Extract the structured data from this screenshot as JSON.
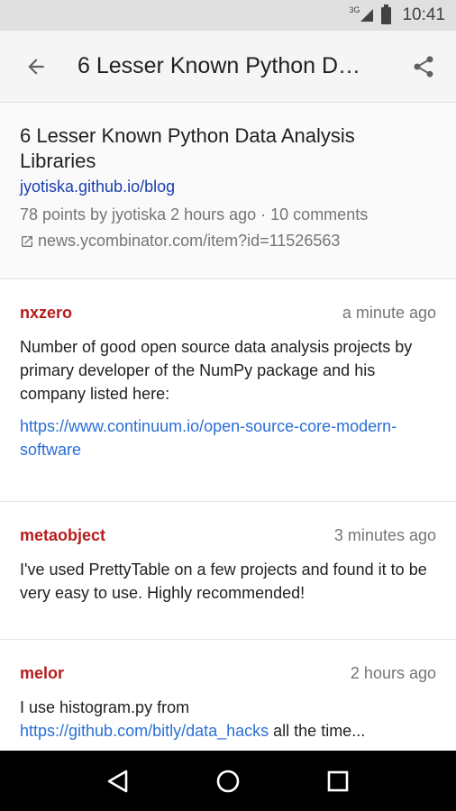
{
  "status_bar": {
    "network": "3G",
    "time": "10:41",
    "icons": [
      "signal-icon",
      "battery-icon"
    ]
  },
  "app_bar": {
    "title": "6 Lesser Known Python D…",
    "icons": [
      "back-arrow-icon",
      "share-icon"
    ]
  },
  "story": {
    "title": "6 Lesser Known Python Data Analysis Libraries",
    "domain": "jyotiska.github.io/blog",
    "meta": "78 points by jyotiska 2 hours ago · 10 comments",
    "link": "news.ycombinator.com/item?id=11526563",
    "link_icon": "external-link-icon"
  },
  "comments": [
    {
      "user": "nxzero",
      "time": "a minute ago",
      "text": "Number of good open source data analysis projects by primary developer of the NumPy package and his company listed here:",
      "link": "https://www.continuum.io/open-source-core-modern-software"
    },
    {
      "user": "metaobject",
      "time": "3 minutes ago",
      "text": "I've used PrettyTable on a few projects and found it to be very easy to use. Highly recommended!"
    },
    {
      "user": "melor",
      "time": "2 hours ago",
      "text_before": "I use histogram.py from ",
      "link": "https://github.com/bitly/data_hacks",
      "text_after": " all the time..."
    }
  ],
  "nav_bar": {
    "icons": [
      "back-triangle-icon",
      "home-circle-icon",
      "recents-square-icon"
    ]
  },
  "colors": {
    "username": "#b71c1c",
    "link": "#2a6ed6",
    "domain": "#1a3fae",
    "app_bar_bg": "#f5f5f5",
    "status_bar_bg": "#e0e0e0"
  }
}
